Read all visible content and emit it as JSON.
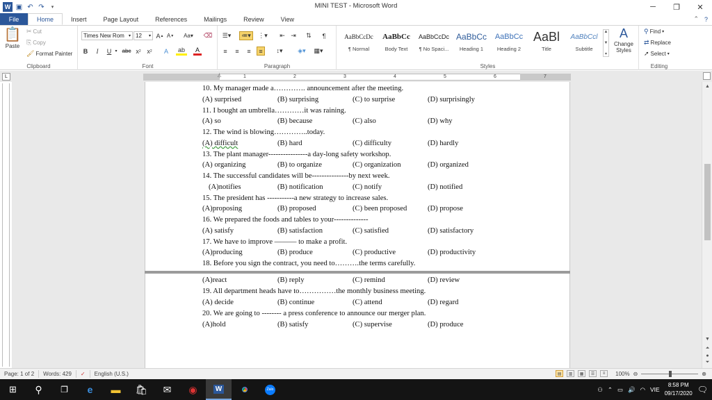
{
  "window": {
    "title": "MINI TEST  -  Microsoft Word",
    "controls": {
      "minimize": "─",
      "restore": "❐",
      "close": "✕"
    }
  },
  "tabs": [
    "File",
    "Home",
    "Insert",
    "Page Layout",
    "References",
    "Mailings",
    "Review",
    "View"
  ],
  "ribbon": {
    "clipboard": {
      "label": "Clipboard",
      "paste": "Paste",
      "cut": "Cut",
      "copy": "Copy",
      "format_painter": "Format Painter"
    },
    "font": {
      "label": "Font",
      "font_name": "Times New Rom",
      "font_size": "12"
    },
    "paragraph": {
      "label": "Paragraph"
    },
    "styles": {
      "label": "Styles",
      "items": [
        {
          "sample": "AaBbCcDc",
          "name": "¶ Normal"
        },
        {
          "sample": "AaBbCc",
          "name": "Body Text"
        },
        {
          "sample": "AaBbCcDc",
          "name": "¶ No Spaci..."
        },
        {
          "sample": "AaBbCc",
          "name": "Heading 1"
        },
        {
          "sample": "AaBbCc",
          "name": "Heading 2"
        },
        {
          "sample": "AaBl",
          "name": "Title"
        },
        {
          "sample": "AaBbCcl",
          "name": "Subtitle"
        }
      ],
      "change_styles": "Change Styles"
    },
    "editing": {
      "label": "Editing",
      "find": "Find",
      "replace": "Replace",
      "select": "Select"
    }
  },
  "document": {
    "page1": [
      {
        "q": "10. My manager made a…………. announcement after the meeting.",
        "opts": [
          "(A) surprised",
          "(B) surprising",
          "(C) to surprise",
          "(D) surprisingly"
        ]
      },
      {
        "q": "11. I bought an umbrella…………it was raining.",
        "opts": [
          "(A) so",
          "(B) because",
          "(C) also",
          "(D) why"
        ]
      },
      {
        "q": "12. The wind is blowing…………..today.",
        "opts": [
          "(A) difficult",
          "(B) hard",
          "(C) difficulty",
          "(D) hardly"
        ]
      },
      {
        "q": "13. The plant manager----------------a  day-long safety workshop.",
        "opts": [
          "(A) organizing",
          "(B) to organize",
          "(C) organization",
          "(D) organized"
        ]
      },
      {
        "q": "14. The successful candidates will be---------------by  next week.",
        "opts": [
          "(A)notifies",
          "(B) notification",
          "(C) notify",
          "(D) notified"
        ]
      },
      {
        "q": "15. The president has -----------a  new strategy to increase  sales.",
        "opts": [
          "(A)proposing",
          "(B) proposed",
          "(C) been proposed",
          "(D) propose"
        ]
      },
      {
        "q": "16. We prepared the foods and tables to your--------------",
        "opts": [
          "(A) satisfy",
          "(B) satisfaction",
          "(C) satisfied",
          "(D) satisfactory"
        ]
      },
      {
        "q": "17. We have to improve ——— to make a profit.",
        "opts": [
          "(A)producing",
          "(B) produce",
          "(C) productive",
          "(D) productivity"
        ]
      },
      {
        "q": "18. Before you sign the contract, you need to……….the terms carefully.",
        "opts": []
      }
    ],
    "page2": [
      {
        "q": "",
        "opts": [
          "(A)react",
          "(B) reply",
          "(C) remind",
          "(D) review"
        ]
      },
      {
        "q": "19. All department heads have to……………the monthly business meeting.",
        "opts": [
          "(A) decide",
          "(B) continue",
          "(C) attend",
          "(D) regard"
        ]
      },
      {
        "q": "20. We are going to -------- a press conference to announce our merger plan.",
        "opts": [
          "(A)hold",
          "(B) satisfy",
          "(C) supervise",
          "(D) produce"
        ]
      }
    ]
  },
  "statusbar": {
    "page": "Page: 1 of 2",
    "words": "Words: 429",
    "language": "English (U.S.)",
    "zoom": "100%"
  },
  "taskbar": {
    "time": "8:58 PM",
    "date": "09/17/2020",
    "lang": "VIE"
  }
}
